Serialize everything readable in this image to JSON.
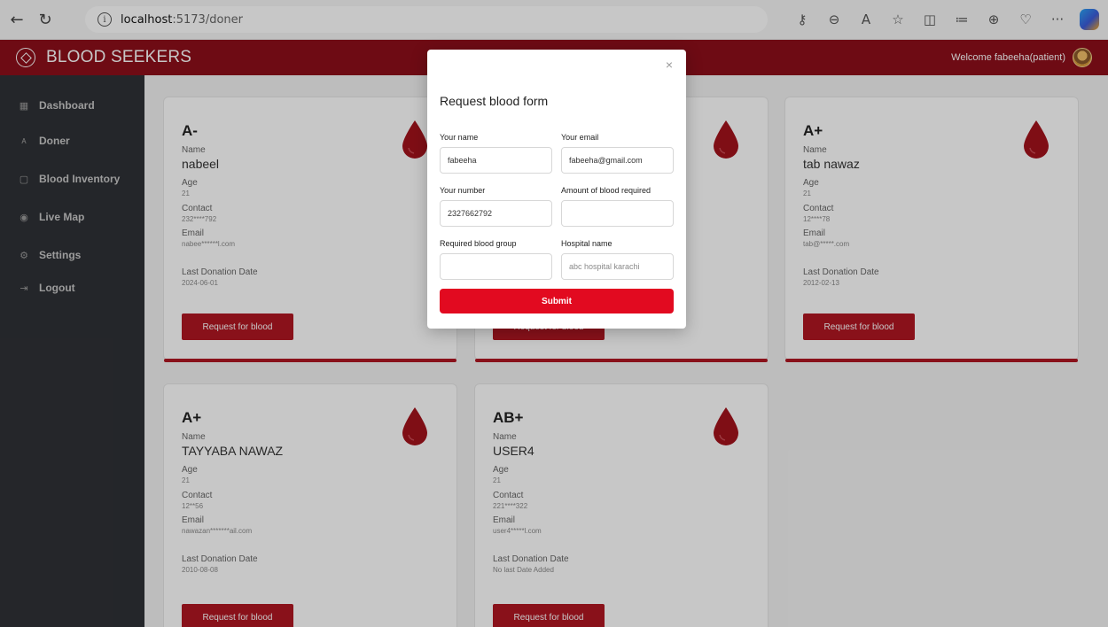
{
  "browser": {
    "url_host": "localhost",
    "url_path": ":5173/doner"
  },
  "header": {
    "brand": "BLOOD SEEKERS",
    "welcome": "Welcome fabeeha(patient)"
  },
  "sidebar": {
    "items": [
      {
        "label": "Dashboard",
        "icon": "grid-icon"
      },
      {
        "label": "Doner",
        "icon": "users-icon"
      },
      {
        "label": "Blood Inventory",
        "icon": "inventory-icon"
      },
      {
        "label": "Live Map",
        "icon": "map-pin-icon"
      },
      {
        "label": "Settings",
        "icon": "gear-icon"
      },
      {
        "label": "Logout",
        "icon": "logout-icon"
      }
    ]
  },
  "labels": {
    "name": "Name",
    "age": "Age",
    "contact": "Contact",
    "email": "Email",
    "last_donation": "Last Donation Date",
    "request_button": "Request for blood"
  },
  "cards": [
    {
      "group": "A-",
      "name": "nabeel",
      "age": "21",
      "contact": "232****792",
      "email": "nabee******l.com",
      "last_donation": "2024-06-01"
    },
    {
      "group": "",
      "name": "",
      "age": "",
      "contact": "",
      "email": "",
      "last_donation": ""
    },
    {
      "group": "A+",
      "name": "tab nawaz",
      "age": "21",
      "contact": "12****78",
      "email": "tab@*****.com",
      "last_donation": "2012-02-13"
    },
    {
      "group": "A+",
      "name": "TAYYABA NAWAZ",
      "age": "21",
      "contact": "12**56",
      "email": "nawazan*******ail.com",
      "last_donation": "2010-08-08"
    },
    {
      "group": "AB+",
      "name": "USER4",
      "age": "21",
      "contact": "221****322",
      "email": "user4*****l.com",
      "last_donation": "No last Date Added"
    }
  ],
  "modal": {
    "title": "Request blood form",
    "close": "×",
    "fields": {
      "name_label": "Your name",
      "name_value": "fabeeha",
      "email_label": "Your email",
      "email_value": "fabeeha@gmail.com",
      "number_label": "Your number",
      "number_value": "2327662792",
      "amount_label": "Amount of blood required",
      "amount_value": "",
      "group_label": "Required blood group",
      "group_value": "",
      "hospital_label": "Hospital name",
      "hospital_placeholder": "abc hospital karachi"
    },
    "submit": "Submit"
  },
  "colors": {
    "brand": "#8e0f1a",
    "accent": "#b01622",
    "submit": "#e20a20",
    "sidebar": "#2f3136"
  }
}
